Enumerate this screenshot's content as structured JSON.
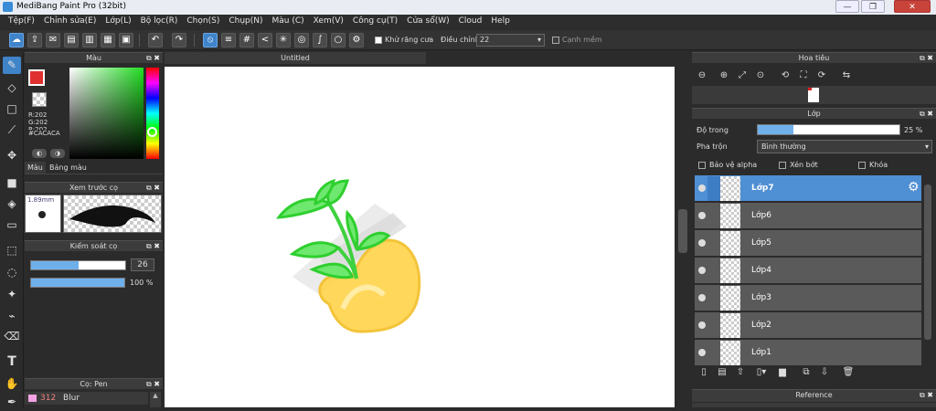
{
  "window": {
    "title": "MediBang Paint Pro (32bit)"
  },
  "menu": [
    "Tệp(F)",
    "Chỉnh sửa(E)",
    "Lớp(L)",
    "Bộ lọc(R)",
    "Chọn(S)",
    "Chụp(N)",
    "Màu (C)",
    "Xem(V)",
    "Công cụ(T)",
    "Cửa sổ(W)",
    "Cloud",
    "Help"
  ],
  "toolbar": {
    "antialias_label": "Khử răng cưa",
    "adjust_label": "Điều chỉnh",
    "adjust_value": "22",
    "sharp_edge_label": "Cạnh mềm"
  },
  "color_panel": {
    "title": "Màu",
    "r": "R:202",
    "g": "G:202",
    "b": "B:202",
    "hex": "#CACACA",
    "tab_color": "Màu",
    "tab_palette": "Bảng màu",
    "primary_color": "#e03030",
    "secondary_color": "#cacaca"
  },
  "brush_preview": {
    "title": "Xem trước cọ",
    "size": "1.89mm"
  },
  "brush_control": {
    "title": "Kiểm soát cọ",
    "size_value": "26",
    "opacity_value": "100 %",
    "size_fraction": 0.26,
    "opacity_fraction": 1.0
  },
  "brush_list": {
    "title": "Cọ: Pen",
    "first_item_number": "312",
    "first_item_name": "Blur"
  },
  "document": {
    "tab_title": "Untitled"
  },
  "navigator": {
    "title": "Hoa tiêu"
  },
  "layer_panel": {
    "title": "Lớp",
    "opacity_label": "Độ trong",
    "opacity_value": "25 %",
    "opacity_fraction": 0.25,
    "blend_label": "Pha trộn",
    "blend_value": "Bình thường",
    "protect_alpha": "Bảo vệ alpha",
    "clipping": "Xén bớt",
    "lock": "Khóa",
    "layers": [
      {
        "name": "Lớp7",
        "selected": true
      },
      {
        "name": "Lớp6",
        "selected": false
      },
      {
        "name": "Lớp5",
        "selected": false
      },
      {
        "name": "Lớp4",
        "selected": false
      },
      {
        "name": "Lớp3",
        "selected": false
      },
      {
        "name": "Lớp2",
        "selected": false
      },
      {
        "name": "Lớp1",
        "selected": false
      }
    ]
  },
  "reference_panel": {
    "title": "Reference"
  }
}
